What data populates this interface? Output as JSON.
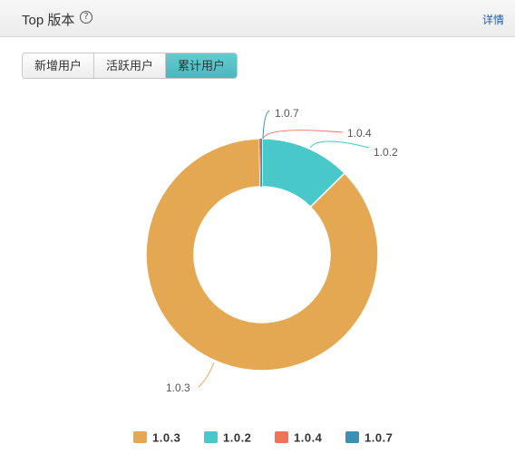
{
  "header": {
    "title": "Top 版本",
    "help_icon": "?",
    "details_label": "详情"
  },
  "tabs": [
    {
      "label": "新增用户",
      "active": false
    },
    {
      "label": "活跃用户",
      "active": false
    },
    {
      "label": "累计用户",
      "active": true
    }
  ],
  "chart_data": {
    "type": "pie",
    "donut": true,
    "categories": [
      "1.0.3",
      "1.0.2",
      "1.0.4",
      "1.0.7"
    ],
    "values": [
      87.0,
      12.6,
      0.2,
      0.2
    ],
    "colors": [
      "#e5a852",
      "#48c8c9",
      "#ee7358",
      "#3d90b3"
    ],
    "legend_position": "bottom-center"
  }
}
